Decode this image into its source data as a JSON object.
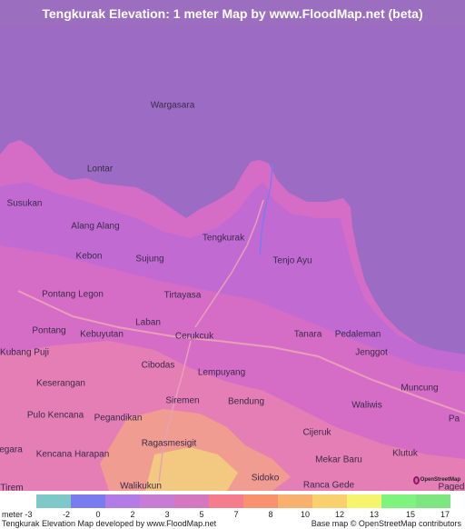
{
  "title": "Tengkurak Elevation: 1 meter Map by www.FloodMap.net (beta)",
  "places": [
    {
      "key": "wargasara",
      "name": "Wargasara"
    },
    {
      "key": "lontar",
      "name": "Lontar"
    },
    {
      "key": "susukan",
      "name": "Susukan"
    },
    {
      "key": "alang-alang",
      "name": "Alang Alang"
    },
    {
      "key": "tengkurak",
      "name": "Tengkurak"
    },
    {
      "key": "kebon",
      "name": "Kebon"
    },
    {
      "key": "sujung",
      "name": "Sujung"
    },
    {
      "key": "tenjo-ayu",
      "name": "Tenjo Ayu"
    },
    {
      "key": "pontang-legon",
      "name": "Pontang Legon"
    },
    {
      "key": "tirtayasa",
      "name": "Tirtayasa"
    },
    {
      "key": "laban",
      "name": "Laban"
    },
    {
      "key": "pontang",
      "name": "Pontang"
    },
    {
      "key": "kebuyutan",
      "name": "Kebuyutan"
    },
    {
      "key": "cerukcuk",
      "name": "Cerukcuk"
    },
    {
      "key": "tanara",
      "name": "Tanara"
    },
    {
      "key": "pedaleman",
      "name": "Pedaleman"
    },
    {
      "key": "kubang-puji",
      "name": "Kubang Puji"
    },
    {
      "key": "cibodas",
      "name": "Cibodas"
    },
    {
      "key": "lempuyang",
      "name": "Lempuyang"
    },
    {
      "key": "jenggot",
      "name": "Jenggot"
    },
    {
      "key": "keserangan",
      "name": "Keserangan"
    },
    {
      "key": "muncung",
      "name": "Muncung"
    },
    {
      "key": "siremen",
      "name": "Siremen"
    },
    {
      "key": "bendung",
      "name": "Bendung"
    },
    {
      "key": "pulo-kencana",
      "name": "Pulo Kencana"
    },
    {
      "key": "pegandikan",
      "name": "Pegandikan"
    },
    {
      "key": "waliwis",
      "name": "Waliwis"
    },
    {
      "key": "cijeruk",
      "name": "Cijeruk"
    },
    {
      "key": "egara",
      "name": "egara"
    },
    {
      "key": "kencana-harapan",
      "name": "Kencana Harapan"
    },
    {
      "key": "ragasmesigit",
      "name": "Ragasmesigit"
    },
    {
      "key": "klutuk",
      "name": "Klutuk"
    },
    {
      "key": "mekar-baru",
      "name": "Mekar Baru"
    },
    {
      "key": "sidoko",
      "name": "Sidoko"
    },
    {
      "key": "walikukun",
      "name": "Walikukun"
    },
    {
      "key": "ranca-gede",
      "name": "Ranca Gede"
    },
    {
      "key": "tirem",
      "name": "Tirem"
    },
    {
      "key": "pa",
      "name": "Pa"
    },
    {
      "key": "paged",
      "name": "Paged"
    }
  ],
  "legend": {
    "unit": "meter -3",
    "colors": [
      "#7ec8c8",
      "#7b7bf0",
      "#b27ce6",
      "#c87bd4",
      "#d476c0",
      "#f47c8c",
      "#f8926e",
      "#f8b06e",
      "#f8d06e",
      "#f4f46e",
      "#7ef47e",
      "#7ee67e"
    ],
    "ticks": [
      "-2",
      "0",
      "2",
      "3",
      "5",
      "7",
      "8",
      "10",
      "12",
      "13",
      "15",
      "17"
    ]
  },
  "credits": {
    "left": "Tengkurak Elevation Map developed by www.FloodMap.net",
    "right": "Base map © OpenStreetMap contributors"
  },
  "badge": "OpenStreetMap",
  "colors": {
    "sea": "#9c6cc4",
    "land": "#d56dc6",
    "lowland": "#b06adc",
    "title_bar": "#9b6ec0"
  }
}
